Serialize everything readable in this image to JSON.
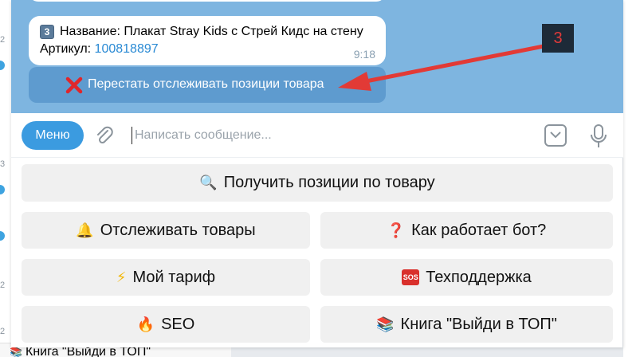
{
  "chat": {
    "product_card": {
      "keycap": "3",
      "title_line": "Название: Плакат Stray Kids с Стрей Кидс на стену",
      "article_label": "Артикул: ",
      "article_value": "100818897",
      "time": "9:18"
    },
    "inline_button": {
      "label": "Перестать отслеживать позиции товара"
    },
    "annotation": {
      "label": "3",
      "color": "#e03a3a"
    }
  },
  "composer": {
    "menu_label": "Меню",
    "placeholder": "Написать сообщение..."
  },
  "keyboard": {
    "get_positions": {
      "emoji": "🔍",
      "label": "Получить позиции по товару"
    },
    "track": {
      "emoji": "🔔",
      "label": "Отслеживать товары"
    },
    "how_works": {
      "emoji": "❓",
      "label": "Как работает бот?"
    },
    "tariff": {
      "emoji": "⚡",
      "label": "Мой тариф"
    },
    "support": {
      "emoji": "SOS",
      "label": "Техподдержка"
    },
    "seo": {
      "emoji": "🔥",
      "label": "SEO"
    },
    "book": {
      "emoji": "📚",
      "label": "Книга \"Выйди в ТОП\""
    }
  },
  "background": {
    "list_numbers": [
      "2",
      "3",
      "2",
      "2"
    ],
    "bottom_item": {
      "emoji": "📚",
      "label": "Книга \"Выйди в ТОП\""
    }
  },
  "colors": {
    "accent": "#3b9be0",
    "chat_bg": "#7eb5e0",
    "inline_button": "#5e9bcf",
    "link": "#2a8ad4"
  }
}
